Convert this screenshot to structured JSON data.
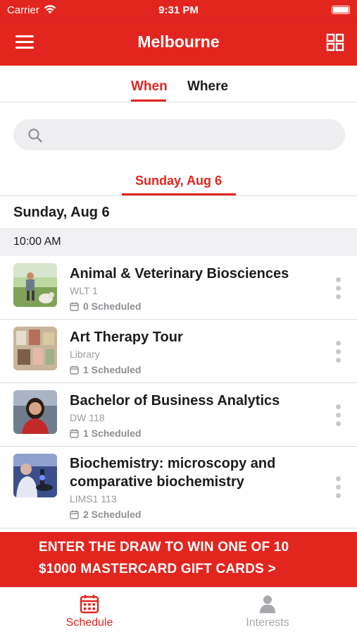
{
  "status_bar": {
    "carrier": "Carrier",
    "time": "9:31 PM"
  },
  "nav": {
    "title": "Melbourne",
    "menu_icon": "hamburger-menu-icon",
    "grid_icon": "grid-view-icon"
  },
  "tabs": [
    {
      "label": "When",
      "active": true
    },
    {
      "label": "Where",
      "active": false
    }
  ],
  "search": {
    "placeholder": "",
    "value": ""
  },
  "date_tab": {
    "label": "Sunday, Aug 6"
  },
  "day_header": "Sunday, Aug 6",
  "time_header": "10:00 AM",
  "items": [
    {
      "title_lines": [
        "Animal & Veterinary Biosciences"
      ],
      "room": "WLT 1",
      "scheduled": "0 Scheduled"
    },
    {
      "title_lines": [
        "Art Therapy Tour"
      ],
      "room": "Library",
      "scheduled": "1 Scheduled"
    },
    {
      "title_lines": [
        "Bachelor of Business Analytics"
      ],
      "room": "DW 118",
      "scheduled": "1 Scheduled"
    },
    {
      "title_lines": [
        "Biochemistry: microscopy and",
        "comparative biochemistry"
      ],
      "room": "LIMS1 113",
      "scheduled": "2 Scheduled"
    }
  ],
  "banner": {
    "line1": "ENTER THE DRAW TO WIN ONE OF 10",
    "line2": "$1000 MASTERCARD GIFT CARDS >"
  },
  "tab_bar": [
    {
      "label": "Schedule",
      "icon": "calendar-icon",
      "active": true
    },
    {
      "label": "Interests",
      "icon": "person-icon",
      "active": false
    }
  ],
  "colors": {
    "brand": "#e3251f",
    "inactive": "#a7a7ac"
  }
}
